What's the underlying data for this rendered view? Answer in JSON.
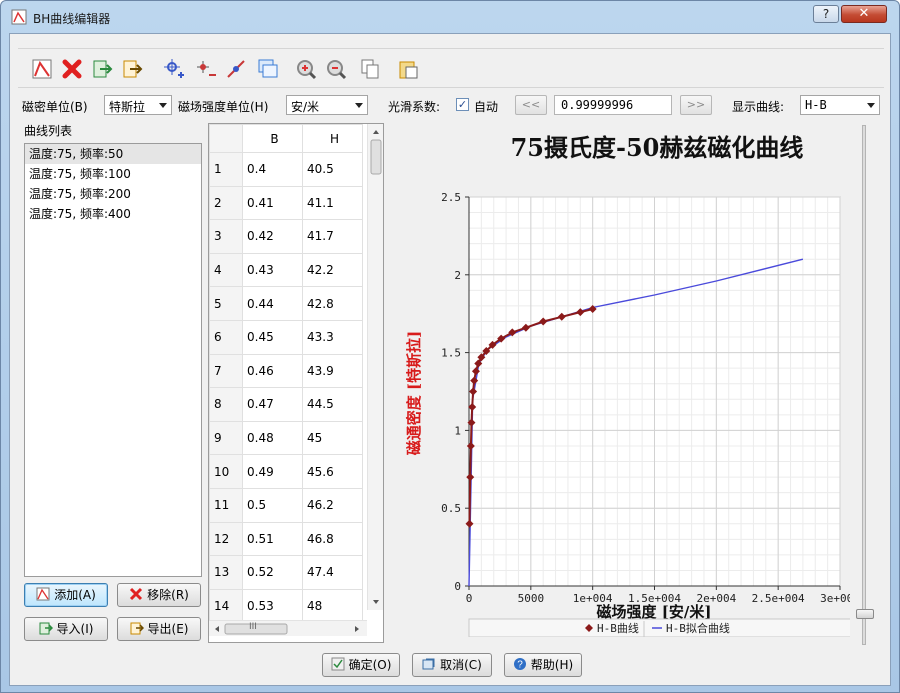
{
  "window": {
    "title": "BH曲线编辑器",
    "help_label": "?",
    "close_label": "✕"
  },
  "toolbar": {
    "buttons": [
      {
        "name": "new-curve-icon",
        "color": "#d33"
      },
      {
        "name": "delete-icon",
        "color": "#e02020"
      },
      {
        "name": "import-icon",
        "color": "#2b8a3e"
      },
      {
        "name": "export-icon",
        "color": "#c98a00"
      },
      {
        "name": "add-point-icon",
        "color": "#3858c8"
      },
      {
        "name": "remove-point-icon",
        "color": "#c83838"
      },
      {
        "name": "edit-point-icon",
        "color": "#c83838"
      },
      {
        "name": "copy-window-icon",
        "color": "#3a7bd5"
      },
      {
        "name": "zoom-icon",
        "color": "#888"
      },
      {
        "name": "zoom-out-icon",
        "color": "#888"
      },
      {
        "name": "copy-icon",
        "color": "#777"
      },
      {
        "name": "paste-icon",
        "color": "#c98a00"
      }
    ]
  },
  "options": {
    "b_unit_label": "磁密单位(B)",
    "b_unit_value": "特斯拉",
    "h_unit_label": "磁场强度单位(H)",
    "h_unit_value": "安/米",
    "smooth_label": "光滑系数:",
    "auto_label": "自动",
    "auto_checked": "✓",
    "prev_label": "<<",
    "smooth_value": "0.99999996",
    "next_label": ">>",
    "display_label": "显示曲线:",
    "display_value": "H-B"
  },
  "curve_list": {
    "title": "曲线列表",
    "items": [
      "温度:75, 频率:50",
      "温度:75, 频率:100",
      "温度:75, 频率:200",
      "温度:75, 频率:400"
    ]
  },
  "list_buttons": {
    "add": "添加(A)",
    "remove": "移除(R)",
    "import": "导入(I)",
    "export": "导出(E)"
  },
  "grid": {
    "headers": [
      "B",
      "H"
    ],
    "rows": [
      [
        "1",
        "0.4",
        "40.5"
      ],
      [
        "2",
        "0.41",
        "41.1"
      ],
      [
        "3",
        "0.42",
        "41.7"
      ],
      [
        "4",
        "0.43",
        "42.2"
      ],
      [
        "5",
        "0.44",
        "42.8"
      ],
      [
        "6",
        "0.45",
        "43.3"
      ],
      [
        "7",
        "0.46",
        "43.9"
      ],
      [
        "8",
        "0.47",
        "44.5"
      ],
      [
        "9",
        "0.48",
        "45"
      ],
      [
        "10",
        "0.49",
        "45.6"
      ],
      [
        "11",
        "0.5",
        "46.2"
      ],
      [
        "12",
        "0.51",
        "46.8"
      ],
      [
        "13",
        "0.52",
        "47.4"
      ],
      [
        "14",
        "0.53",
        "48"
      ]
    ],
    "scroll_mid": "III"
  },
  "footer": {
    "ok": "确定(O)",
    "cancel": "取消(C)",
    "help": "帮助(H)"
  },
  "chart_data": {
    "type": "line",
    "title": "75摄氏度-50赫兹磁化曲线",
    "xlabel": "磁场强度 [安/米]",
    "ylabel": "磁通密度 [特斯拉]",
    "xlim": [
      0,
      30000
    ],
    "ylim": [
      0,
      2.5
    ],
    "xticks": [
      "0",
      "5000",
      "1e+004",
      "1.5e+004",
      "2e+004",
      "2.5e+004",
      "3e+004"
    ],
    "yticks": [
      "0",
      "0.5",
      "1",
      "1.5",
      "2",
      "2.5"
    ],
    "grid": true,
    "legend": "bottom",
    "series": [
      {
        "name": "H-B曲线",
        "color": "#8b1a1a",
        "marker": "diamond",
        "x": [
          40.5,
          100,
          150,
          200,
          260,
          330,
          420,
          560,
          750,
          1000,
          1400,
          1900,
          2600,
          3500,
          4600,
          6000,
          7500,
          9000,
          10000
        ],
        "y": [
          0.4,
          0.7,
          0.9,
          1.05,
          1.15,
          1.25,
          1.32,
          1.38,
          1.43,
          1.47,
          1.51,
          1.55,
          1.59,
          1.63,
          1.66,
          1.7,
          1.73,
          1.76,
          1.78
        ]
      },
      {
        "name": "H-B拟合曲线",
        "color": "#4a4adb",
        "x": [
          0,
          300,
          800,
          1500,
          3000,
          5000,
          7500,
          10000,
          15000,
          20000,
          27000
        ],
        "y": [
          0,
          1.2,
          1.43,
          1.52,
          1.6,
          1.67,
          1.73,
          1.79,
          1.87,
          1.96,
          2.1
        ]
      }
    ]
  }
}
